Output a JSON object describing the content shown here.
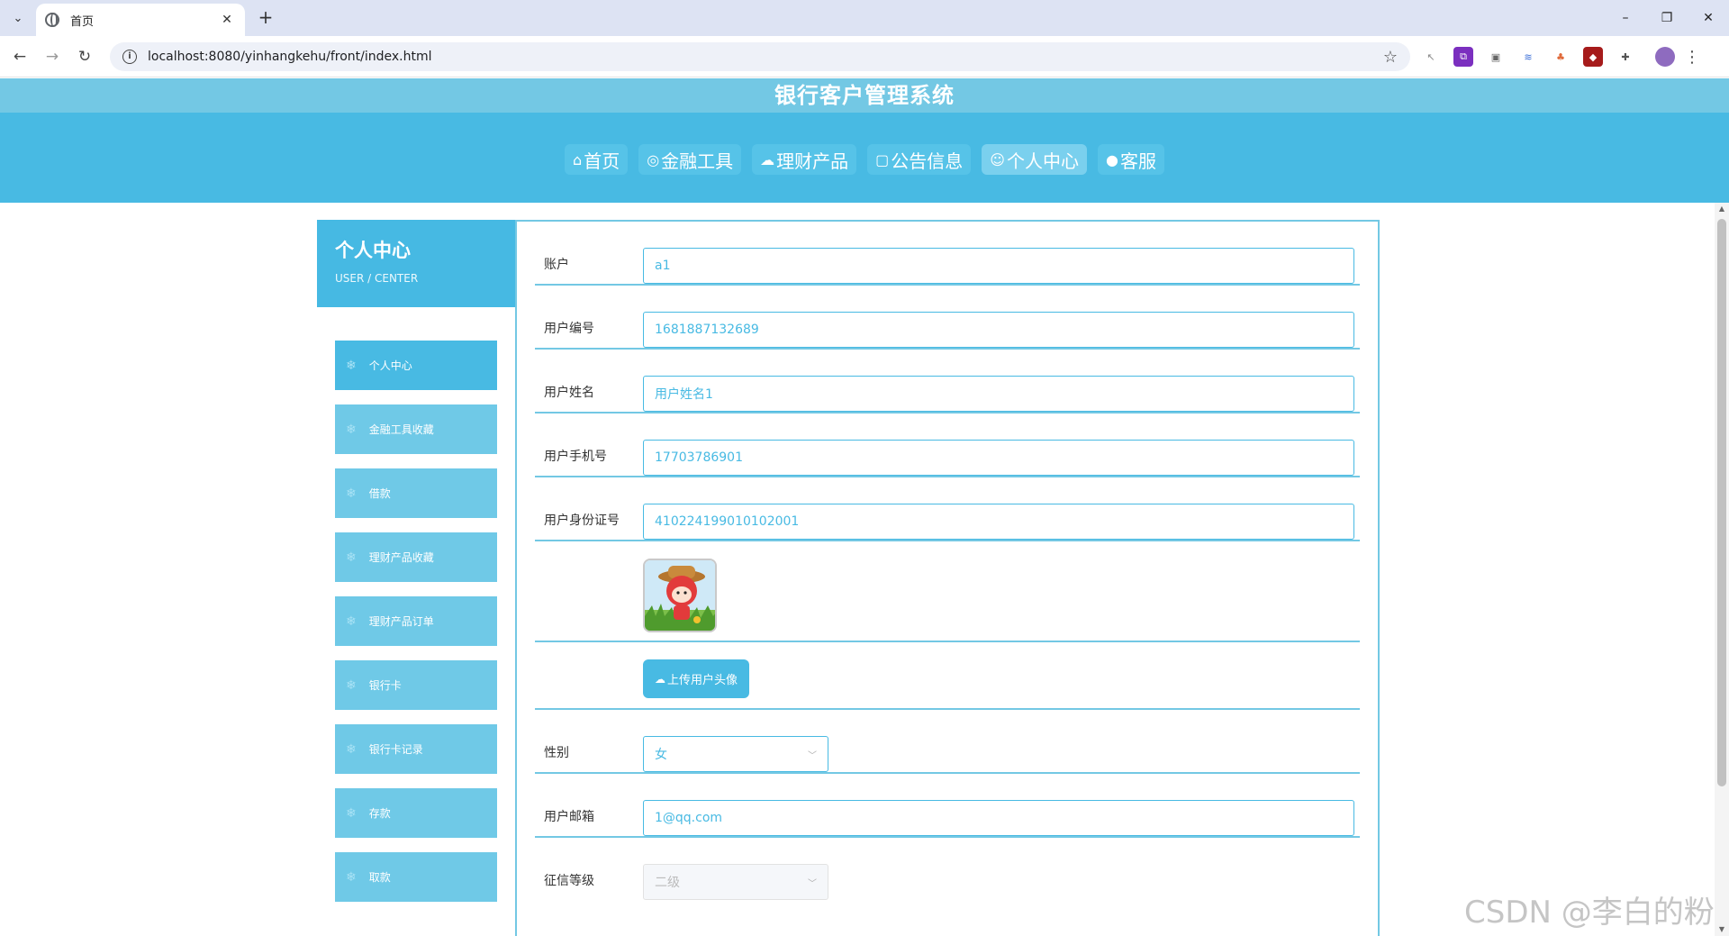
{
  "browser": {
    "tab_title": "首页",
    "tab_close": "✕",
    "new_tab": "+",
    "url": "localhost:8080/yinhangkehu/front/index.html",
    "window_controls": [
      "–",
      "❐",
      "✕"
    ]
  },
  "site": {
    "title": "银行客户管理系统",
    "nav": [
      {
        "icon": "⌂",
        "label": "首页"
      },
      {
        "icon": "◎",
        "label": "金融工具"
      },
      {
        "icon": "☁",
        "label": "理财产品"
      },
      {
        "icon": "▢",
        "label": "公告信息"
      },
      {
        "icon": "☺",
        "label": "个人中心"
      },
      {
        "icon": "●",
        "label": "客服"
      }
    ]
  },
  "sidebar": {
    "title": "个人中心",
    "subtitle": "USER / CENTER",
    "items": [
      {
        "label": "个人中心"
      },
      {
        "label": "金融工具收藏"
      },
      {
        "label": "借款"
      },
      {
        "label": "理财产品收藏"
      },
      {
        "label": "理财产品订单"
      },
      {
        "label": "银行卡"
      },
      {
        "label": "银行卡记录"
      },
      {
        "label": "存款"
      },
      {
        "label": "取款"
      }
    ]
  },
  "form": {
    "account_label": "账户",
    "account_value": "a1",
    "user_no_label": "用户编号",
    "user_no_value": "1681887132689",
    "name_label": "用户姓名",
    "name_value": "用户姓名1",
    "phone_label": "用户手机号",
    "phone_value": "17703786901",
    "idcard_label": "用户身份证号",
    "idcard_value": "410224199010102001",
    "upload_label": "上传用户头像",
    "gender_label": "性别",
    "gender_value": "女",
    "email_label": "用户邮箱",
    "email_value": "1@qq.com",
    "credit_label": "征信等级",
    "credit_value": "二级"
  },
  "watermark": "CSDN @李白的粉",
  "colors": {
    "primary": "#48bae3",
    "light": "#73c8e4",
    "menu": "#6fc9e7"
  }
}
